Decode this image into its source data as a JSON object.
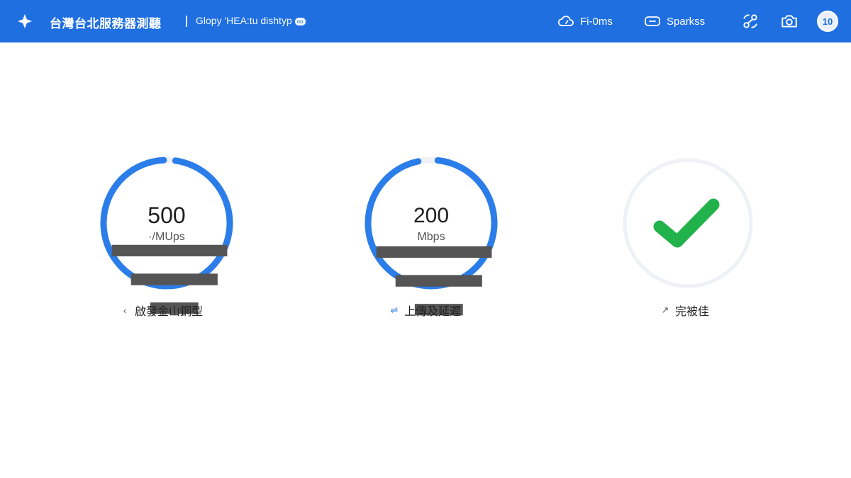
{
  "colors": {
    "header_bg": "#1f6fe0",
    "gauge_blue": "#2b7de9",
    "track_gray": "#eef1f5",
    "check_green": "#22b24c"
  },
  "header": {
    "title": "台灣台北服務器測聽",
    "subtitle": "Glopy 'HEA:tu dishtyp",
    "subtitle_badge": "oo",
    "ping_icon": "cloud-gauge-icon",
    "ping_label": "Fi-0ms",
    "server_icon": "toggle-icon",
    "server_label": "Sparkss",
    "share_icon": "share-link-icon",
    "camera_icon": "camera-icon",
    "avatar_text": "10"
  },
  "gauges": [
    {
      "id": "download",
      "value": "500",
      "unit": "·/MUps",
      "label": "啟發金山鋼型",
      "label_icon": "‹",
      "progress": 0.97
    },
    {
      "id": "upload",
      "value": "200",
      "unit": "Mbps",
      "label": "上傳及延遲",
      "label_icon": "⇌",
      "progress": 0.95
    },
    {
      "id": "done",
      "label": "完被佳",
      "label_icon": "↗",
      "status": "complete"
    }
  ]
}
